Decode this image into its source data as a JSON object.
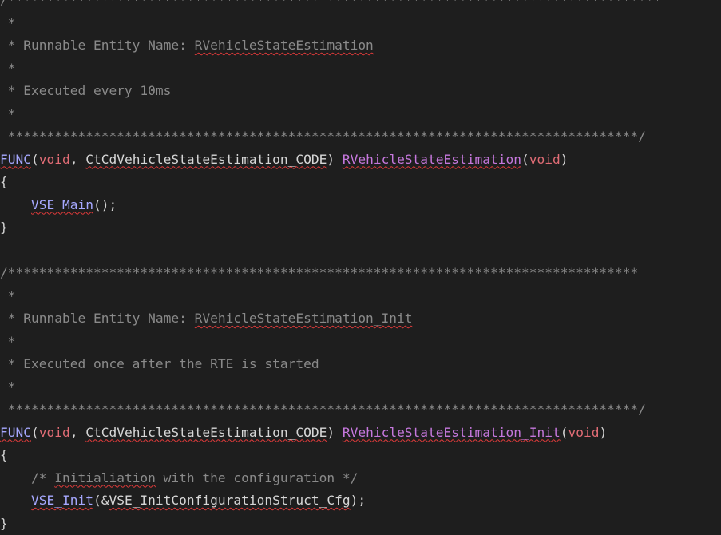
{
  "editor": {
    "lines": [
      {
        "tokens": [
          {
            "t": "/************************************************************************************",
            "c": "cm"
          }
        ]
      },
      {
        "tokens": [
          {
            "t": " *",
            "c": "cm"
          }
        ]
      },
      {
        "tokens": [
          {
            "t": " * Runnable Entity Name: ",
            "c": "cm"
          },
          {
            "t": "RVehicleStateEstimation",
            "c": "cm",
            "sq": true
          }
        ]
      },
      {
        "tokens": [
          {
            "t": " *",
            "c": "cm"
          }
        ]
      },
      {
        "tokens": [
          {
            "t": " * Executed every 10ms",
            "c": "cm"
          }
        ]
      },
      {
        "tokens": [
          {
            "t": " *",
            "c": "cm"
          }
        ]
      },
      {
        "tokens": [
          {
            "t": " *********************************************************************************/",
            "c": "cm"
          }
        ]
      },
      {
        "tokens": [
          {
            "t": "FUNC",
            "c": "macro",
            "sq": true
          },
          {
            "t": "(",
            "c": "pn"
          },
          {
            "t": "void",
            "c": "kw"
          },
          {
            "t": ", ",
            "c": "pn"
          },
          {
            "t": "CtCdVehicleStateEstimation_CODE",
            "c": "id",
            "sq": true
          },
          {
            "t": ") ",
            "c": "pn"
          },
          {
            "t": "RVehicleStateEstimation",
            "c": "fn",
            "sq": true
          },
          {
            "t": "(",
            "c": "pn"
          },
          {
            "t": "void",
            "c": "kw"
          },
          {
            "t": ")",
            "c": "pn"
          }
        ]
      },
      {
        "tokens": [
          {
            "t": "{",
            "c": "pn"
          }
        ]
      },
      {
        "tokens": [
          {
            "t": "    ",
            "c": "pn"
          },
          {
            "t": "VSE_Main",
            "c": "macro",
            "sq": true
          },
          {
            "t": "();",
            "c": "pn"
          }
        ]
      },
      {
        "tokens": [
          {
            "t": "}",
            "c": "pn"
          }
        ]
      },
      {
        "tokens": [
          {
            "t": "",
            "c": "pn"
          }
        ]
      },
      {
        "tokens": [
          {
            "t": "/*********************************************************************************",
            "c": "cm"
          }
        ]
      },
      {
        "tokens": [
          {
            "t": " *",
            "c": "cm"
          }
        ]
      },
      {
        "tokens": [
          {
            "t": " * Runnable Entity Name: ",
            "c": "cm"
          },
          {
            "t": "RVehicleStateEstimation_Init",
            "c": "cm",
            "sq": true
          }
        ]
      },
      {
        "tokens": [
          {
            "t": " *",
            "c": "cm"
          }
        ]
      },
      {
        "tokens": [
          {
            "t": " * Executed once after the RTE is started",
            "c": "cm"
          }
        ]
      },
      {
        "tokens": [
          {
            "t": " *",
            "c": "cm"
          }
        ]
      },
      {
        "tokens": [
          {
            "t": " *********************************************************************************/",
            "c": "cm"
          }
        ]
      },
      {
        "tokens": [
          {
            "t": "FUNC",
            "c": "macro",
            "sq": true
          },
          {
            "t": "(",
            "c": "pn"
          },
          {
            "t": "void",
            "c": "kw"
          },
          {
            "t": ", ",
            "c": "pn"
          },
          {
            "t": "CtCdVehicleStateEstimation_CODE",
            "c": "id",
            "sq": true
          },
          {
            "t": ") ",
            "c": "pn"
          },
          {
            "t": "RVehicleStateEstimation_Init",
            "c": "fn",
            "sq": true
          },
          {
            "t": "(",
            "c": "pn"
          },
          {
            "t": "void",
            "c": "kw"
          },
          {
            "t": ")",
            "c": "pn"
          }
        ]
      },
      {
        "tokens": [
          {
            "t": "{",
            "c": "pn"
          }
        ]
      },
      {
        "tokens": [
          {
            "t": "    ",
            "c": "pn"
          },
          {
            "t": "/* ",
            "c": "cm"
          },
          {
            "t": "Initialiation",
            "c": "cm",
            "sq": true
          },
          {
            "t": " with the configuration */",
            "c": "cm"
          }
        ]
      },
      {
        "tokens": [
          {
            "t": "    ",
            "c": "pn"
          },
          {
            "t": "VSE_Init",
            "c": "macro",
            "sq": true
          },
          {
            "t": "(&",
            "c": "pn"
          },
          {
            "t": "VSE_InitConfigurationStruct_Cfg",
            "c": "id",
            "sq": true
          },
          {
            "t": ");",
            "c": "pn"
          }
        ]
      },
      {
        "tokens": [
          {
            "t": "}",
            "c": "pn"
          }
        ]
      }
    ]
  }
}
